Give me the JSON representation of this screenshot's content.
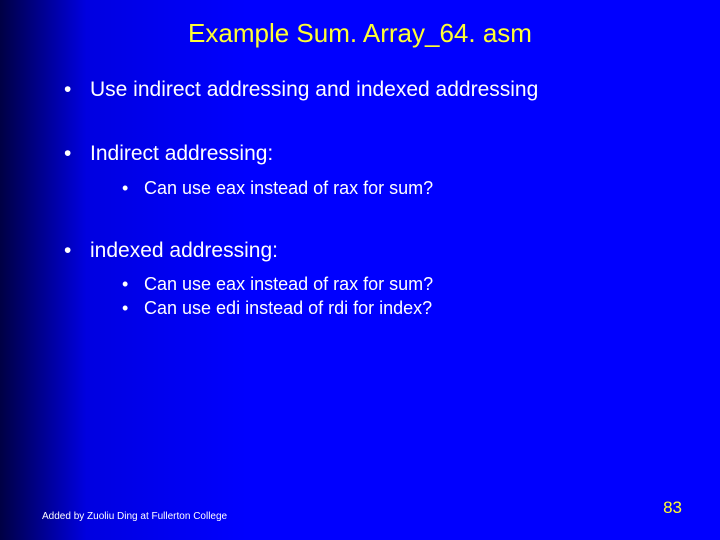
{
  "title": "Example Sum. Array_64. asm",
  "bullets": {
    "b1": "Use indirect addressing and indexed addressing",
    "b2": "Indirect addressing:",
    "b2_sub1": "Can use eax instead of rax for sum?",
    "b3": "indexed addressing:",
    "b3_sub1": "Can use eax instead of rax for sum?",
    "b3_sub2": "Can use edi instead of rdi for index?"
  },
  "footer": {
    "left": "Added by Zuoliu Ding at Fullerton College",
    "page": "83"
  }
}
